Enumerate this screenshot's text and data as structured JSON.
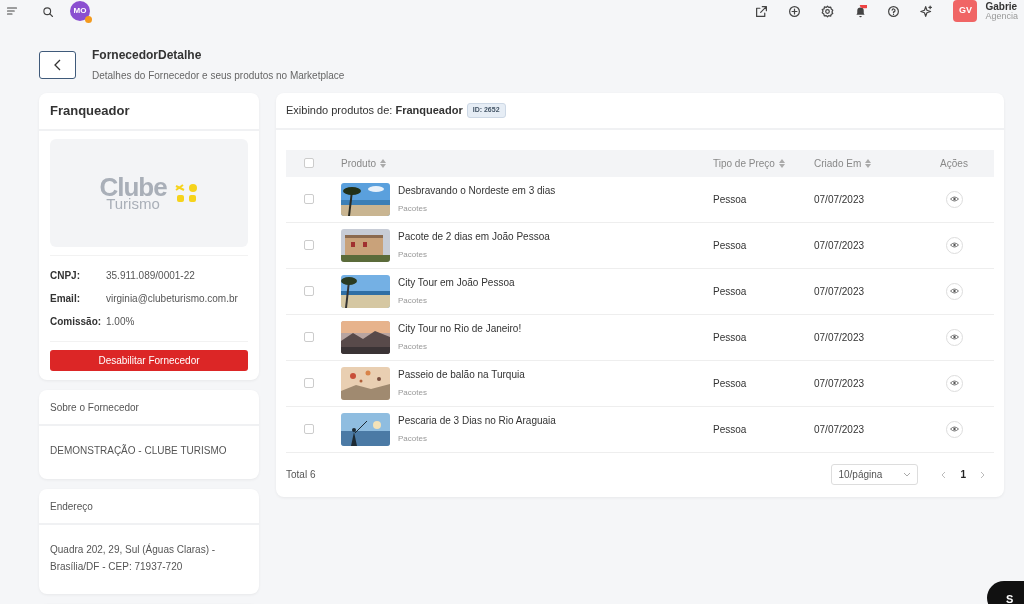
{
  "topbar": {
    "avatar": "MO",
    "user_initials": "GV",
    "user_name": "Gabrie",
    "user_role": "Agencia"
  },
  "header": {
    "title": "FornecedorDetalhe",
    "subtitle": "Detalhes do Fornecedor e seus produtos no Marketplace"
  },
  "supplier": {
    "name": "Franqueador",
    "logo_line1": "Clube",
    "logo_line2": "Turismo",
    "fields": [
      {
        "label": "CNPJ:",
        "value": "35.911.089/0001-22"
      },
      {
        "label": "Email:",
        "value": "virginia@clubeturismo.com.br"
      },
      {
        "label": "Comissão:",
        "value": "1.00%"
      }
    ],
    "disable_button": "Desabilitar Fornecedor"
  },
  "about": {
    "title": "Sobre o Fornecedor",
    "text": "DEMONSTRAÇÃO - CLUBE TURISMO"
  },
  "address": {
    "title": "Endereço",
    "text": "Quadra 202, 29, Sul (Águas Claras) - Brasília/DF - CEP: 71937-720"
  },
  "products": {
    "select_all_checked": false,
    "heading_prefix": "Exibindo produtos de:",
    "heading_name": "Franqueador",
    "id_badge": "ID: 2652",
    "columns": [
      {
        "label": "Produto",
        "sortable": true
      },
      {
        "label": "Tipo de Preço",
        "sortable": true
      },
      {
        "label": "Criado Em",
        "sortable": true
      },
      {
        "label": "Ações",
        "sortable": false
      }
    ],
    "rows": [
      {
        "name": "Desbravando o Nordeste em 3 dias",
        "category": "Pacotes",
        "price_type": "Pessoa",
        "created": "07/07/2023",
        "selected": false
      },
      {
        "name": "Pacote de 2 dias em João Pessoa",
        "category": "Pacotes",
        "price_type": "Pessoa",
        "created": "07/07/2023",
        "selected": false
      },
      {
        "name": "City Tour em João Pessoa",
        "category": "Pacotes",
        "price_type": "Pessoa",
        "created": "07/07/2023",
        "selected": false
      },
      {
        "name": "City Tour no Rio de Janeiro!",
        "category": "Pacotes",
        "price_type": "Pessoa",
        "created": "07/07/2023",
        "selected": false
      },
      {
        "name": "Passeio de balão na Turquia",
        "category": "Pacotes",
        "price_type": "Pessoa",
        "created": "07/07/2023",
        "selected": false
      },
      {
        "name": "Pescaria de 3 Dias no Rio Araguaia",
        "category": "Pacotes",
        "price_type": "Pessoa",
        "created": "07/07/2023",
        "selected": false
      }
    ],
    "total": "Total 6",
    "page_size": "10/página",
    "pages": [
      {
        "label": "1",
        "selected": true
      }
    ]
  },
  "chat_button": "S"
}
